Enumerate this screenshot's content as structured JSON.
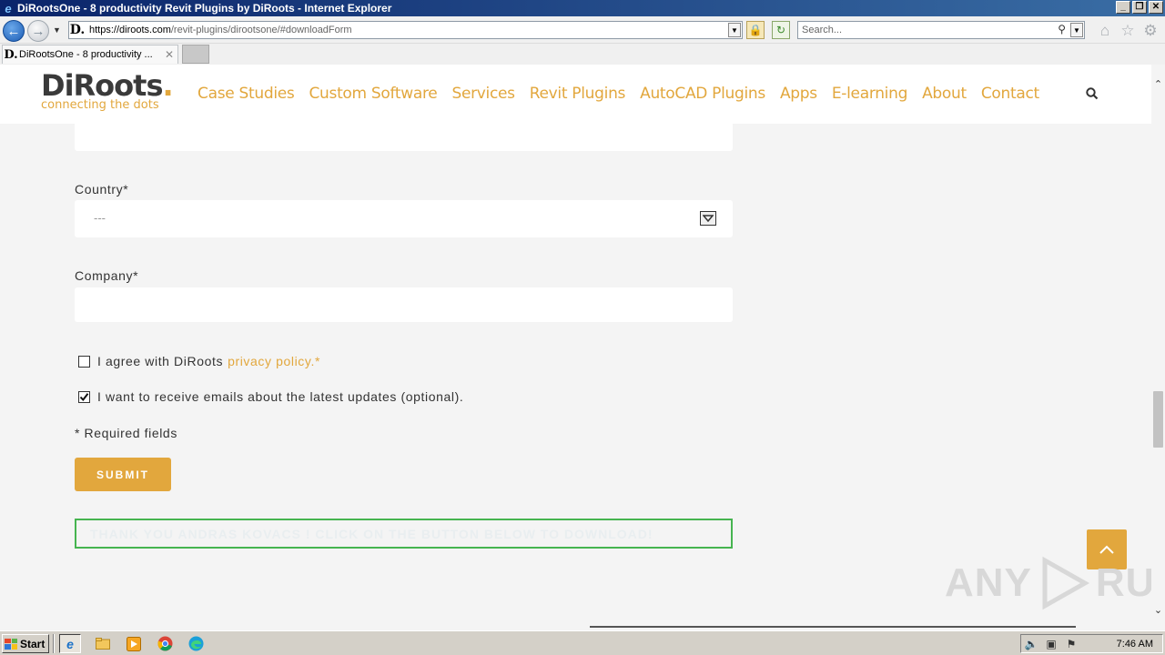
{
  "window": {
    "title": "DiRootsOne - 8 productivity Revit Plugins by DiRoots - Internet Explorer",
    "min": "_",
    "restore": "❐",
    "close": "✕"
  },
  "browser": {
    "url_host": "https://diroots.com",
    "url_path": "/revit-plugins/dirootsone/#downloadForm",
    "search_placeholder": "Search...",
    "favicon": "D.",
    "tab_label": "DiRootsOne - 8 productivity ...",
    "tab_close": "✕",
    "icons": [
      "back-icon",
      "forward-icon",
      "lock-icon",
      "refresh-icon",
      "search-icon",
      "home-icon",
      "favorites-star-icon",
      "gear-icon"
    ]
  },
  "site": {
    "logo_text": "DiRoots",
    "logo_dot": ".",
    "logo_tagline": "connecting the dots",
    "menu": [
      "Case Studies",
      "Custom Software",
      "Services",
      "Revit Plugins",
      "AutoCAD Plugins",
      "Apps",
      "E-learning",
      "About",
      "Contact"
    ],
    "accent_color": "#e2a73d"
  },
  "form": {
    "country_label": "Country*",
    "country_value": "---",
    "company_label": "Company*",
    "company_value": "",
    "privacy_text": "I agree with DiRoots",
    "privacy_link": "privacy policy.*",
    "privacy_checked": false,
    "emails_text": "I want to receive emails about the latest updates (optional).",
    "emails_checked": true,
    "required_note": "* Required fields",
    "submit_label": "SUBMIT",
    "success_message": "THANK YOU ANDRAS KOVACS ! CLICK ON THE BUTTON BELOW TO DOWNLOAD!",
    "success_color": "#46b450"
  },
  "watermark": {
    "left": "ANY",
    "right": "RUN"
  },
  "taskbar": {
    "start_label": "Start",
    "clock": "7:46 AM"
  }
}
